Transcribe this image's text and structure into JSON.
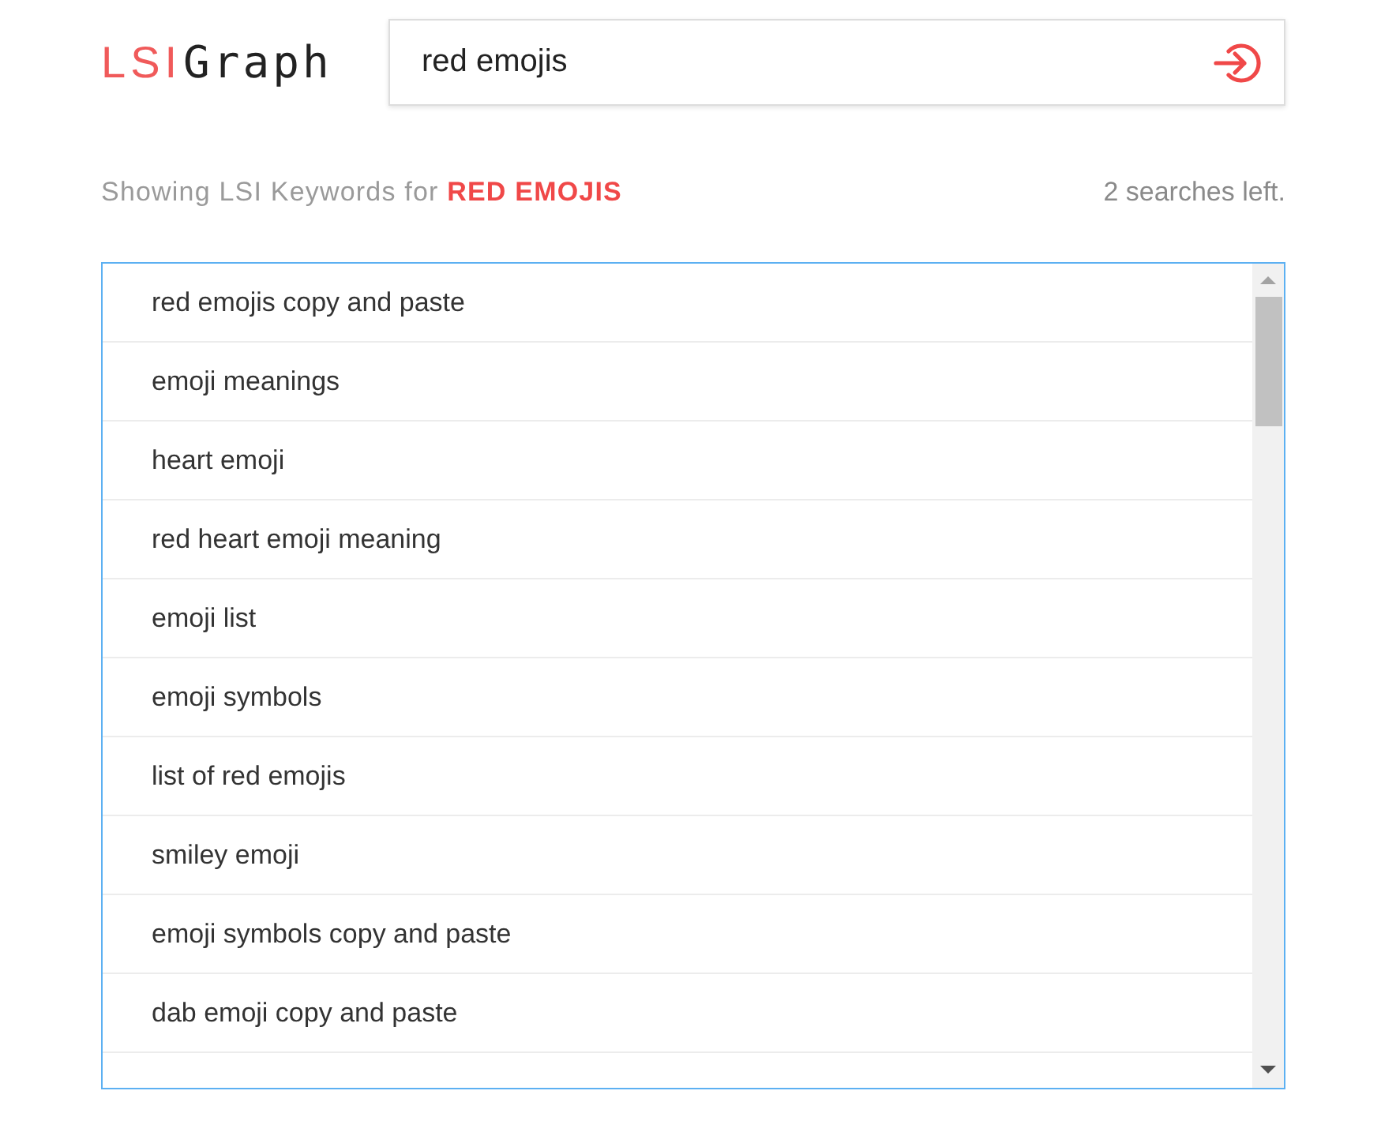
{
  "logo": {
    "part_1": "LSI",
    "part_2": "Graph"
  },
  "search": {
    "value": "red emojis"
  },
  "summary": {
    "prefix": "Showing LSI Keywords for",
    "query": "RED EMOJIS",
    "remaining": "2 searches left."
  },
  "keywords": [
    "red emojis copy and paste",
    "emoji meanings",
    "heart emoji",
    "red heart emoji meaning",
    "emoji list",
    "emoji symbols",
    "list of red emojis",
    "smiley emoji",
    "emoji symbols copy and paste",
    "dab emoji copy and paste"
  ]
}
